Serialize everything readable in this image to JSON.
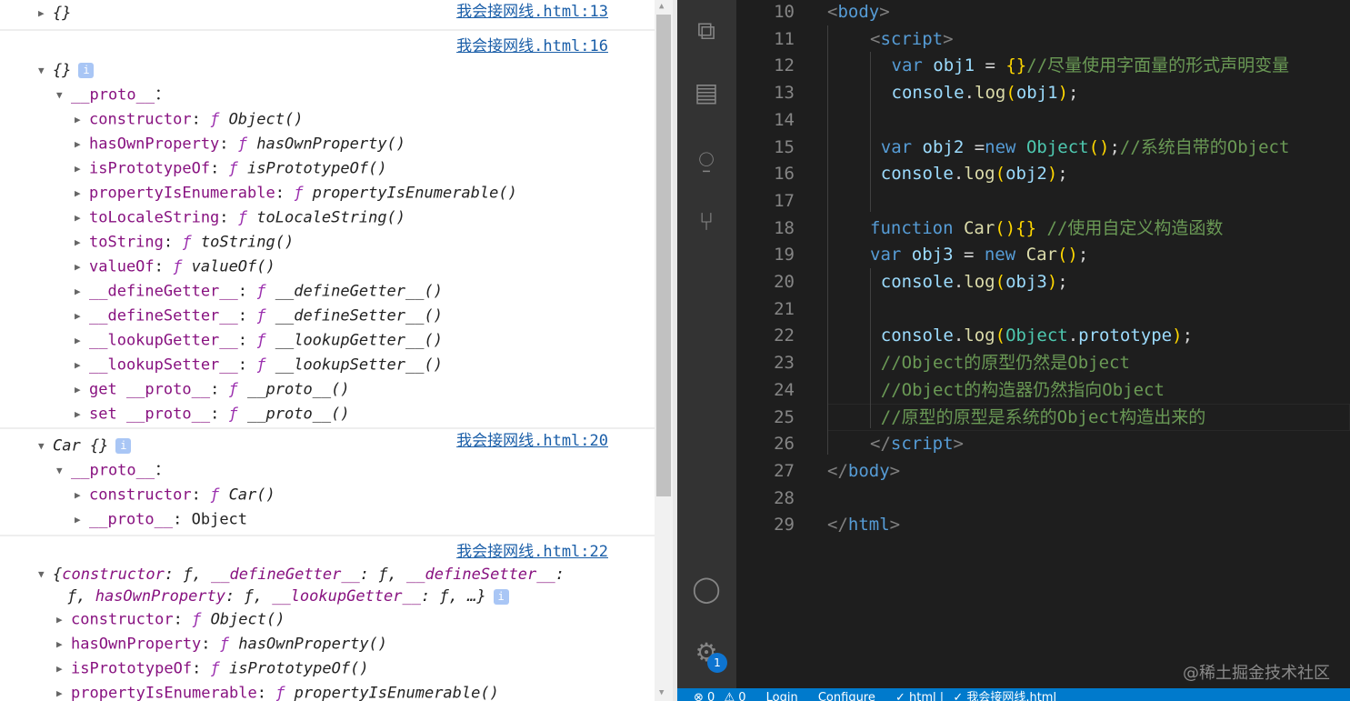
{
  "console": {
    "groups": [
      {
        "link": "我会接网线.html:13",
        "link_row": 0,
        "rows": [
          {
            "indent": 0,
            "arrow": "right",
            "parts": [
              [
                "it",
                "{}"
              ]
            ]
          }
        ]
      },
      {
        "link": "我会接网线.html:16",
        "link_row": 0,
        "lead_blank": true,
        "rows": [
          {
            "indent": 0,
            "arrow": "down",
            "parts": [
              [
                "it",
                "{}"
              ]
            ],
            "info": "i"
          },
          {
            "indent": 1,
            "arrow": "down",
            "parts": [
              [
                "key",
                "__proto__"
              ],
              [
                "",
                "："
              ]
            ]
          },
          {
            "indent": 2,
            "arrow": "right",
            "parts": [
              [
                "key",
                "constructor"
              ],
              [
                "",
                ": "
              ],
              [
                "fn",
                "ƒ "
              ],
              [
                "it",
                "Object()"
              ]
            ]
          },
          {
            "indent": 2,
            "arrow": "right",
            "parts": [
              [
                "key",
                "hasOwnProperty"
              ],
              [
                "",
                ": "
              ],
              [
                "fn",
                "ƒ "
              ],
              [
                "it",
                "hasOwnProperty()"
              ]
            ]
          },
          {
            "indent": 2,
            "arrow": "right",
            "parts": [
              [
                "key",
                "isPrototypeOf"
              ],
              [
                "",
                ": "
              ],
              [
                "fn",
                "ƒ "
              ],
              [
                "it",
                "isPrototypeOf()"
              ]
            ]
          },
          {
            "indent": 2,
            "arrow": "right",
            "parts": [
              [
                "key",
                "propertyIsEnumerable"
              ],
              [
                "",
                ": "
              ],
              [
                "fn",
                "ƒ "
              ],
              [
                "it",
                "propertyIsEnumerable()"
              ]
            ]
          },
          {
            "indent": 2,
            "arrow": "right",
            "parts": [
              [
                "key",
                "toLocaleString"
              ],
              [
                "",
                ": "
              ],
              [
                "fn",
                "ƒ "
              ],
              [
                "it",
                "toLocaleString()"
              ]
            ]
          },
          {
            "indent": 2,
            "arrow": "right",
            "parts": [
              [
                "key",
                "toString"
              ],
              [
                "",
                ": "
              ],
              [
                "fn",
                "ƒ "
              ],
              [
                "it",
                "toString()"
              ]
            ]
          },
          {
            "indent": 2,
            "arrow": "right",
            "parts": [
              [
                "key",
                "valueOf"
              ],
              [
                "",
                ": "
              ],
              [
                "fn",
                "ƒ "
              ],
              [
                "it",
                "valueOf()"
              ]
            ]
          },
          {
            "indent": 2,
            "arrow": "right",
            "parts": [
              [
                "key",
                "__defineGetter__"
              ],
              [
                "",
                ": "
              ],
              [
                "fn",
                "ƒ "
              ],
              [
                "it",
                "__defineGetter__()"
              ]
            ]
          },
          {
            "indent": 2,
            "arrow": "right",
            "parts": [
              [
                "key",
                "__defineSetter__"
              ],
              [
                "",
                ": "
              ],
              [
                "fn",
                "ƒ "
              ],
              [
                "it",
                "__defineSetter__()"
              ]
            ]
          },
          {
            "indent": 2,
            "arrow": "right",
            "parts": [
              [
                "key",
                "__lookupGetter__"
              ],
              [
                "",
                ": "
              ],
              [
                "fn",
                "ƒ "
              ],
              [
                "it",
                "__lookupGetter__()"
              ]
            ]
          },
          {
            "indent": 2,
            "arrow": "right",
            "parts": [
              [
                "key",
                "__lookupSetter__"
              ],
              [
                "",
                ": "
              ],
              [
                "fn",
                "ƒ "
              ],
              [
                "it",
                "__lookupSetter__()"
              ]
            ]
          },
          {
            "indent": 2,
            "arrow": "right",
            "parts": [
              [
                "key",
                "get __proto__"
              ],
              [
                "",
                ": "
              ],
              [
                "fn",
                "ƒ "
              ],
              [
                "it",
                "__proto__()"
              ]
            ]
          },
          {
            "indent": 2,
            "arrow": "right",
            "parts": [
              [
                "key",
                "set __proto__"
              ],
              [
                "",
                ": "
              ],
              [
                "fn",
                "ƒ "
              ],
              [
                "it",
                "__proto__()"
              ]
            ]
          }
        ]
      },
      {
        "link": "我会接网线.html:20",
        "link_row": 0,
        "rows": [
          {
            "indent": 0,
            "arrow": "down",
            "parts": [
              [
                "it",
                "Car {}"
              ]
            ],
            "info": "i"
          },
          {
            "indent": 1,
            "arrow": "down",
            "parts": [
              [
                "key",
                "__proto__"
              ],
              [
                "",
                "："
              ]
            ]
          },
          {
            "indent": 2,
            "arrow": "right",
            "parts": [
              [
                "key",
                "constructor"
              ],
              [
                "",
                ": "
              ],
              [
                "fn",
                "ƒ "
              ],
              [
                "it",
                "Car()"
              ]
            ]
          },
          {
            "indent": 2,
            "arrow": "right",
            "parts": [
              [
                "key",
                "__proto__"
              ],
              [
                "",
                ": "
              ],
              [
                "",
                "Object"
              ]
            ]
          }
        ]
      },
      {
        "link": "我会接网线.html:22",
        "link_row": 0,
        "lead_blank": true,
        "rows": [
          {
            "indent": 0,
            "arrow": "down",
            "parts": [
              [
                "it",
                "{"
              ],
              [
                "it key",
                "constructor"
              ],
              [
                "it",
                ": ƒ, "
              ],
              [
                "it key",
                "__defineGetter__"
              ],
              [
                "it",
                ": ƒ, "
              ],
              [
                "it key",
                "__defineSetter__"
              ],
              [
                "it",
                ":"
              ]
            ]
          },
          {
            "indent": 0,
            "arrow": "none",
            "parts": [
              [
                "it",
                "ƒ, "
              ],
              [
                "it key",
                "hasOwnProperty"
              ],
              [
                "it",
                ": ƒ, "
              ],
              [
                "it key",
                "__lookupGetter__"
              ],
              [
                "it",
                ": ƒ, …}"
              ]
            ],
            "info": "i"
          },
          {
            "indent": 1,
            "arrow": "right",
            "parts": [
              [
                "key",
                "constructor"
              ],
              [
                "",
                ": "
              ],
              [
                "fn",
                "ƒ "
              ],
              [
                "it",
                "Object()"
              ]
            ]
          },
          {
            "indent": 1,
            "arrow": "right",
            "parts": [
              [
                "key",
                "hasOwnProperty"
              ],
              [
                "",
                ": "
              ],
              [
                "fn",
                "ƒ "
              ],
              [
                "it",
                "hasOwnProperty()"
              ]
            ]
          },
          {
            "indent": 1,
            "arrow": "right",
            "parts": [
              [
                "key",
                "isPrototypeOf"
              ],
              [
                "",
                ": "
              ],
              [
                "fn",
                "ƒ "
              ],
              [
                "it",
                "isPrototypeOf()"
              ]
            ]
          },
          {
            "indent": 1,
            "arrow": "right",
            "parts": [
              [
                "key",
                "propertyIsEnumerable"
              ],
              [
                "",
                ": "
              ],
              [
                "fn",
                "ƒ "
              ],
              [
                "it",
                "propertyIsEnumerable()"
              ]
            ]
          }
        ]
      }
    ]
  },
  "editor": {
    "lines": [
      {
        "n": "10",
        "indent": 0,
        "t": [
          [
            "tag",
            "<"
          ],
          [
            "tn",
            "body"
          ],
          [
            "tag",
            ">"
          ]
        ]
      },
      {
        "n": "11",
        "indent": 2,
        "t": [
          [
            "tag",
            "<"
          ],
          [
            "tn",
            "script"
          ],
          [
            "tag",
            ">"
          ]
        ]
      },
      {
        "n": "12",
        "indent": 3,
        "t": [
          [
            "kw",
            "var "
          ],
          [
            "var",
            "obj1 "
          ],
          [
            "op",
            "= "
          ],
          [
            "br",
            "{}"
          ],
          [
            "cm",
            "//尽量使用字面量的形式声明变量"
          ]
        ]
      },
      {
        "n": "13",
        "indent": 3,
        "t": [
          [
            "var",
            "console"
          ],
          [
            "op",
            "."
          ],
          [
            "fn",
            "log"
          ],
          [
            "br",
            "("
          ],
          [
            "var",
            "obj1"
          ],
          [
            "br",
            ")"
          ],
          [
            "op",
            ";"
          ]
        ]
      },
      {
        "n": "14",
        "indent": 0,
        "t": []
      },
      {
        "n": "15",
        "indent": 2.5,
        "t": [
          [
            "kw",
            "var "
          ],
          [
            "var",
            "obj2 "
          ],
          [
            "op",
            "="
          ],
          [
            "kw",
            "new "
          ],
          [
            "cls",
            "Object"
          ],
          [
            "br",
            "()"
          ],
          [
            "op",
            ";"
          ],
          [
            "cm",
            "//系统自带的Object"
          ]
        ]
      },
      {
        "n": "16",
        "indent": 2.5,
        "t": [
          [
            "var",
            "console"
          ],
          [
            "op",
            "."
          ],
          [
            "fn",
            "log"
          ],
          [
            "br",
            "("
          ],
          [
            "var",
            "obj2"
          ],
          [
            "br",
            ")"
          ],
          [
            "op",
            ";"
          ]
        ]
      },
      {
        "n": "17",
        "indent": 0,
        "t": []
      },
      {
        "n": "18",
        "indent": 2,
        "t": [
          [
            "kw",
            "function "
          ],
          [
            "fn",
            "Car"
          ],
          [
            "br",
            "(){}"
          ],
          [
            "pl",
            "  "
          ],
          [
            "cm",
            "//使用自定义构造函数"
          ]
        ]
      },
      {
        "n": "19",
        "indent": 2,
        "t": [
          [
            "kw",
            "var "
          ],
          [
            "var",
            "obj3 "
          ],
          [
            "op",
            "= "
          ],
          [
            "kw",
            "new "
          ],
          [
            "fn",
            "Car"
          ],
          [
            "br",
            "()"
          ],
          [
            "op",
            ";"
          ]
        ]
      },
      {
        "n": "20",
        "indent": 2.5,
        "t": [
          [
            "var",
            "console"
          ],
          [
            "op",
            "."
          ],
          [
            "fn",
            "log"
          ],
          [
            "br",
            "("
          ],
          [
            "var",
            "obj3"
          ],
          [
            "br",
            ")"
          ],
          [
            "op",
            ";"
          ]
        ]
      },
      {
        "n": "21",
        "indent": 0,
        "t": []
      },
      {
        "n": "22",
        "indent": 2.5,
        "t": [
          [
            "var",
            "console"
          ],
          [
            "op",
            "."
          ],
          [
            "fn",
            "log"
          ],
          [
            "br",
            "("
          ],
          [
            "cls",
            "Object"
          ],
          [
            "op",
            "."
          ],
          [
            "var",
            "prototype"
          ],
          [
            "br",
            ")"
          ],
          [
            "op",
            ";"
          ]
        ]
      },
      {
        "n": "23",
        "indent": 2.5,
        "t": [
          [
            "cm",
            "//Object的原型仍然是Object"
          ]
        ]
      },
      {
        "n": "24",
        "indent": 2.5,
        "t": [
          [
            "cm",
            "//Object的构造器仍然指向Object"
          ]
        ]
      },
      {
        "n": "25",
        "indent": 2.5,
        "t": [
          [
            "cm",
            "//原型的原型是系统的Object构造出来的"
          ]
        ]
      },
      {
        "n": "26",
        "indent": 2,
        "t": [
          [
            "tag",
            "</"
          ],
          [
            "tn",
            "script"
          ],
          [
            "tag",
            ">"
          ]
        ]
      },
      {
        "n": "27",
        "indent": 0,
        "t": [
          [
            "tag",
            "</"
          ],
          [
            "tn",
            "body"
          ],
          [
            "tag",
            ">"
          ]
        ]
      },
      {
        "n": "28",
        "indent": 0,
        "t": []
      },
      {
        "n": "29",
        "indent": 0,
        "t": [
          [
            "tag",
            "</"
          ],
          [
            "tn",
            "html"
          ],
          [
            "tag",
            ">"
          ]
        ]
      }
    ]
  },
  "activity": {
    "icons": [
      "extensions-icon",
      "preview-icon",
      "remote-icon",
      "source-control-icon",
      "account-icon",
      "settings-icon"
    ],
    "settings_badge": "1"
  },
  "watermark": "@稀土掘金技术社区",
  "status": {
    "errors": "⊗ 0",
    "warnings": "⚠ 0",
    "login": "Login",
    "configure": "Configure",
    "lang": "✓ html |",
    "file": "✓ 我会接网线.html"
  }
}
